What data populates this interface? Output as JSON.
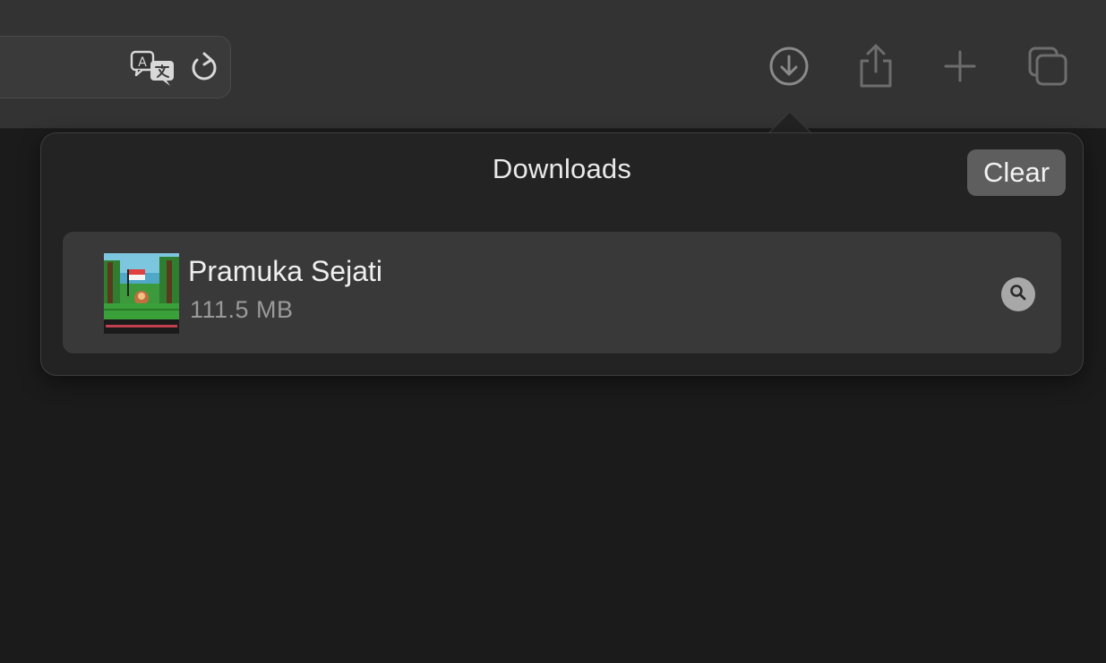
{
  "toolbar": {
    "icons": {
      "translate": "translate-icon",
      "reload": "reload-icon",
      "download": "download-icon",
      "share": "share-icon",
      "new_tab": "plus-icon",
      "tab_overview": "tab-overview-icon"
    }
  },
  "downloads_popover": {
    "title": "Downloads",
    "clear_label": "Clear",
    "items": [
      {
        "name": "Pramuka Sejati",
        "size": "111.5 MB",
        "icon": "magnifying-glass-icon"
      }
    ]
  },
  "colors": {
    "toolbar_bg": "#333333",
    "page_bg": "#1b1b1b",
    "popover_bg": "#232323",
    "item_bg": "#393939",
    "clear_button_bg": "#5e5e5e"
  }
}
